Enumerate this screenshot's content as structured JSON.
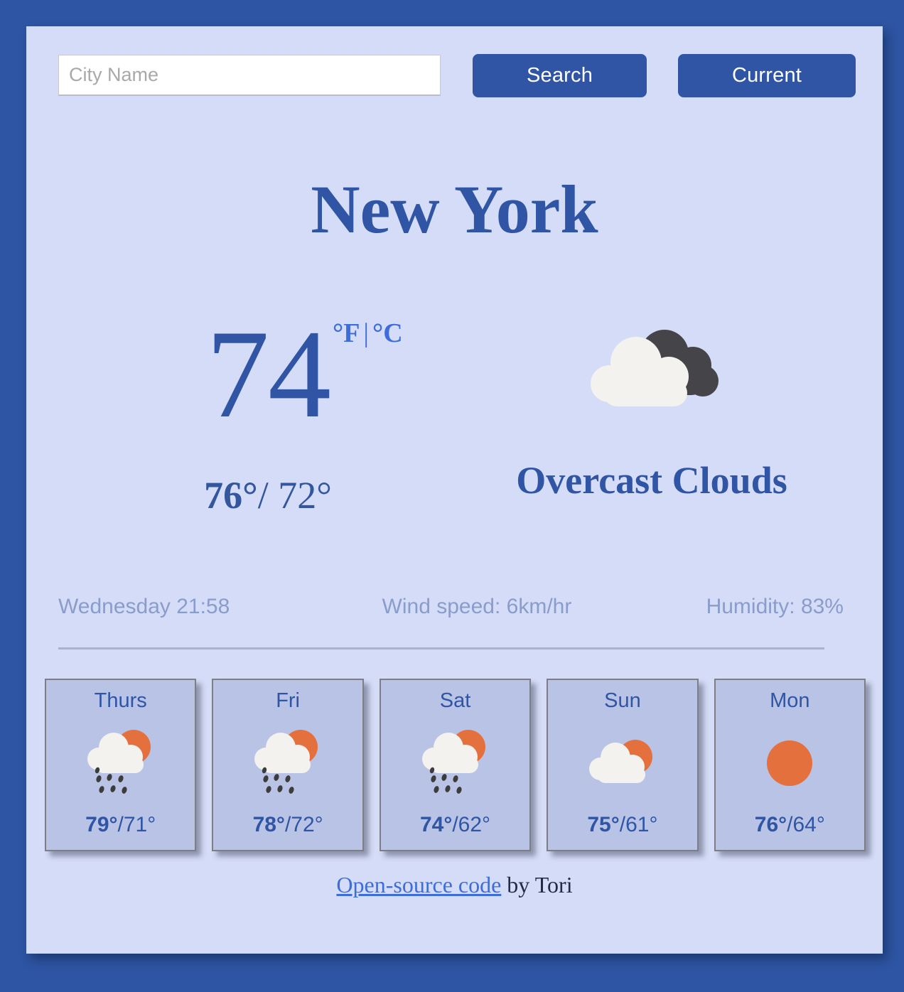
{
  "theme": {
    "page_background": "#2e55a3",
    "card_background": "#d5dcf7",
    "accent_blue": "#2f55a4",
    "link_blue": "#3d6ddb",
    "muted_text": "#8a9ccb",
    "forecast_card_background": "#b9c3e6",
    "sun_orange": "#e4703d",
    "cloud_white": "#f3f2ee",
    "cloud_dark": "#454549"
  },
  "search": {
    "placeholder": "City Name",
    "value": "",
    "search_label": "Search",
    "current_label": "Current"
  },
  "current": {
    "city": "New York",
    "temperature": "74",
    "unit_fahrenheit": "°F",
    "unit_separator": "|",
    "unit_celsius": "°C",
    "high": "76°",
    "low": "/ 72°",
    "condition": "Overcast Clouds",
    "condition_icon": "overcast-clouds-icon",
    "datetime": "Wednesday 21:58",
    "wind": "Wind speed: 6km/hr",
    "humidity": "Humidity: 83%"
  },
  "forecast": [
    {
      "day": "Thurs",
      "icon": "sun-cloud-rain-icon",
      "high": "79°",
      "low": "/71°"
    },
    {
      "day": "Fri",
      "icon": "sun-cloud-rain-icon",
      "high": "78°",
      "low": "/72°"
    },
    {
      "day": "Sat",
      "icon": "sun-cloud-rain-icon",
      "high": "74°",
      "low": "/62°"
    },
    {
      "day": "Sun",
      "icon": "sun-cloud-icon",
      "high": "75°",
      "low": "/61°"
    },
    {
      "day": "Mon",
      "icon": "sun-icon",
      "high": "76°",
      "low": "/64°"
    }
  ],
  "footer": {
    "link_text": "Open-source code",
    "suffix": " by Tori"
  }
}
